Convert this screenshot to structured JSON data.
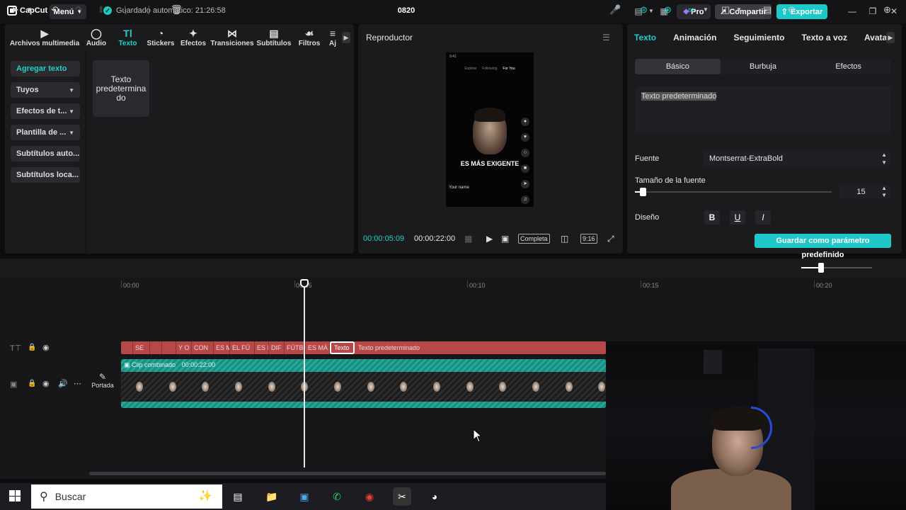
{
  "titlebar": {
    "app_name": "CapCut",
    "menu_label": "Menú",
    "autosave_text": "Guardado automático: 21:26:58",
    "project_title": "0820",
    "pro_label": "Pro",
    "share_label": "Compartir",
    "export_label": "Exportar"
  },
  "tools": [
    {
      "label": "Archivos multimedia",
      "icon": "media-icon"
    },
    {
      "label": "Audio",
      "icon": "audio-icon"
    },
    {
      "label": "Texto",
      "icon": "text-icon"
    },
    {
      "label": "Stickers",
      "icon": "sticker-icon"
    },
    {
      "label": "Efectos",
      "icon": "effects-icon"
    },
    {
      "label": "Transiciones",
      "icon": "transitions-icon"
    },
    {
      "label": "Subtítulos",
      "icon": "subtitles-icon"
    },
    {
      "label": "Filtros",
      "icon": "filters-icon"
    },
    {
      "label": "Aj",
      "icon": "adjust-icon"
    }
  ],
  "left_nav": [
    {
      "label": "Agregar texto"
    },
    {
      "label": "Tuyos"
    },
    {
      "label": "Efectos de t..."
    },
    {
      "label": "Plantilla de ..."
    },
    {
      "label": "Subtítulos auto..."
    },
    {
      "label": "Subtítulos loca..."
    }
  ],
  "text_card_label": "Texto predetermina do",
  "player": {
    "title": "Reproductor",
    "caption": "ES MÁS EXIGENTE",
    "phone_tabs": [
      "Explore",
      "Following",
      "For You"
    ],
    "phone_name": "Your name",
    "current_time": "00:00:05:09",
    "total_time": "00:00:22:00",
    "complete_label": "Completa",
    "ratio_label": "9:16"
  },
  "right_panel": {
    "tabs": [
      "Texto",
      "Animación",
      "Seguimiento",
      "Texto a voz",
      "Avatare"
    ],
    "subtabs": [
      "Básico",
      "Burbuja",
      "Efectos"
    ],
    "text_value": "Texto predeterminado",
    "font_label": "Fuente",
    "font_value": "Montserrat-ExtraBold",
    "size_label": "Tamaño de la fuente",
    "size_value": "15",
    "design_label": "Diseño",
    "bold": "B",
    "underline": "U",
    "italic": "I",
    "save_preset_label": "Guardar como parámetro predefinido"
  },
  "timeline": {
    "ruler": [
      "00:00",
      "00:05",
      "00:10",
      "00:15",
      "00:20"
    ],
    "text_segments": [
      "SE",
      "",
      "",
      "Y O",
      "CON",
      "ES M",
      "EL FÚ",
      "ES I",
      "DIF",
      "FÚTB",
      "ES MÁ",
      "Texto",
      "Texto predeterminado"
    ],
    "clip_label": "Clip combinado",
    "clip_duration": "00:00:22:00",
    "cover_label": "Portada"
  },
  "taskbar": {
    "search_placeholder": "Buscar"
  },
  "colors": {
    "accent": "#1fc8c8",
    "text_track": "#b74848",
    "video_track": "#1b8c7f"
  }
}
